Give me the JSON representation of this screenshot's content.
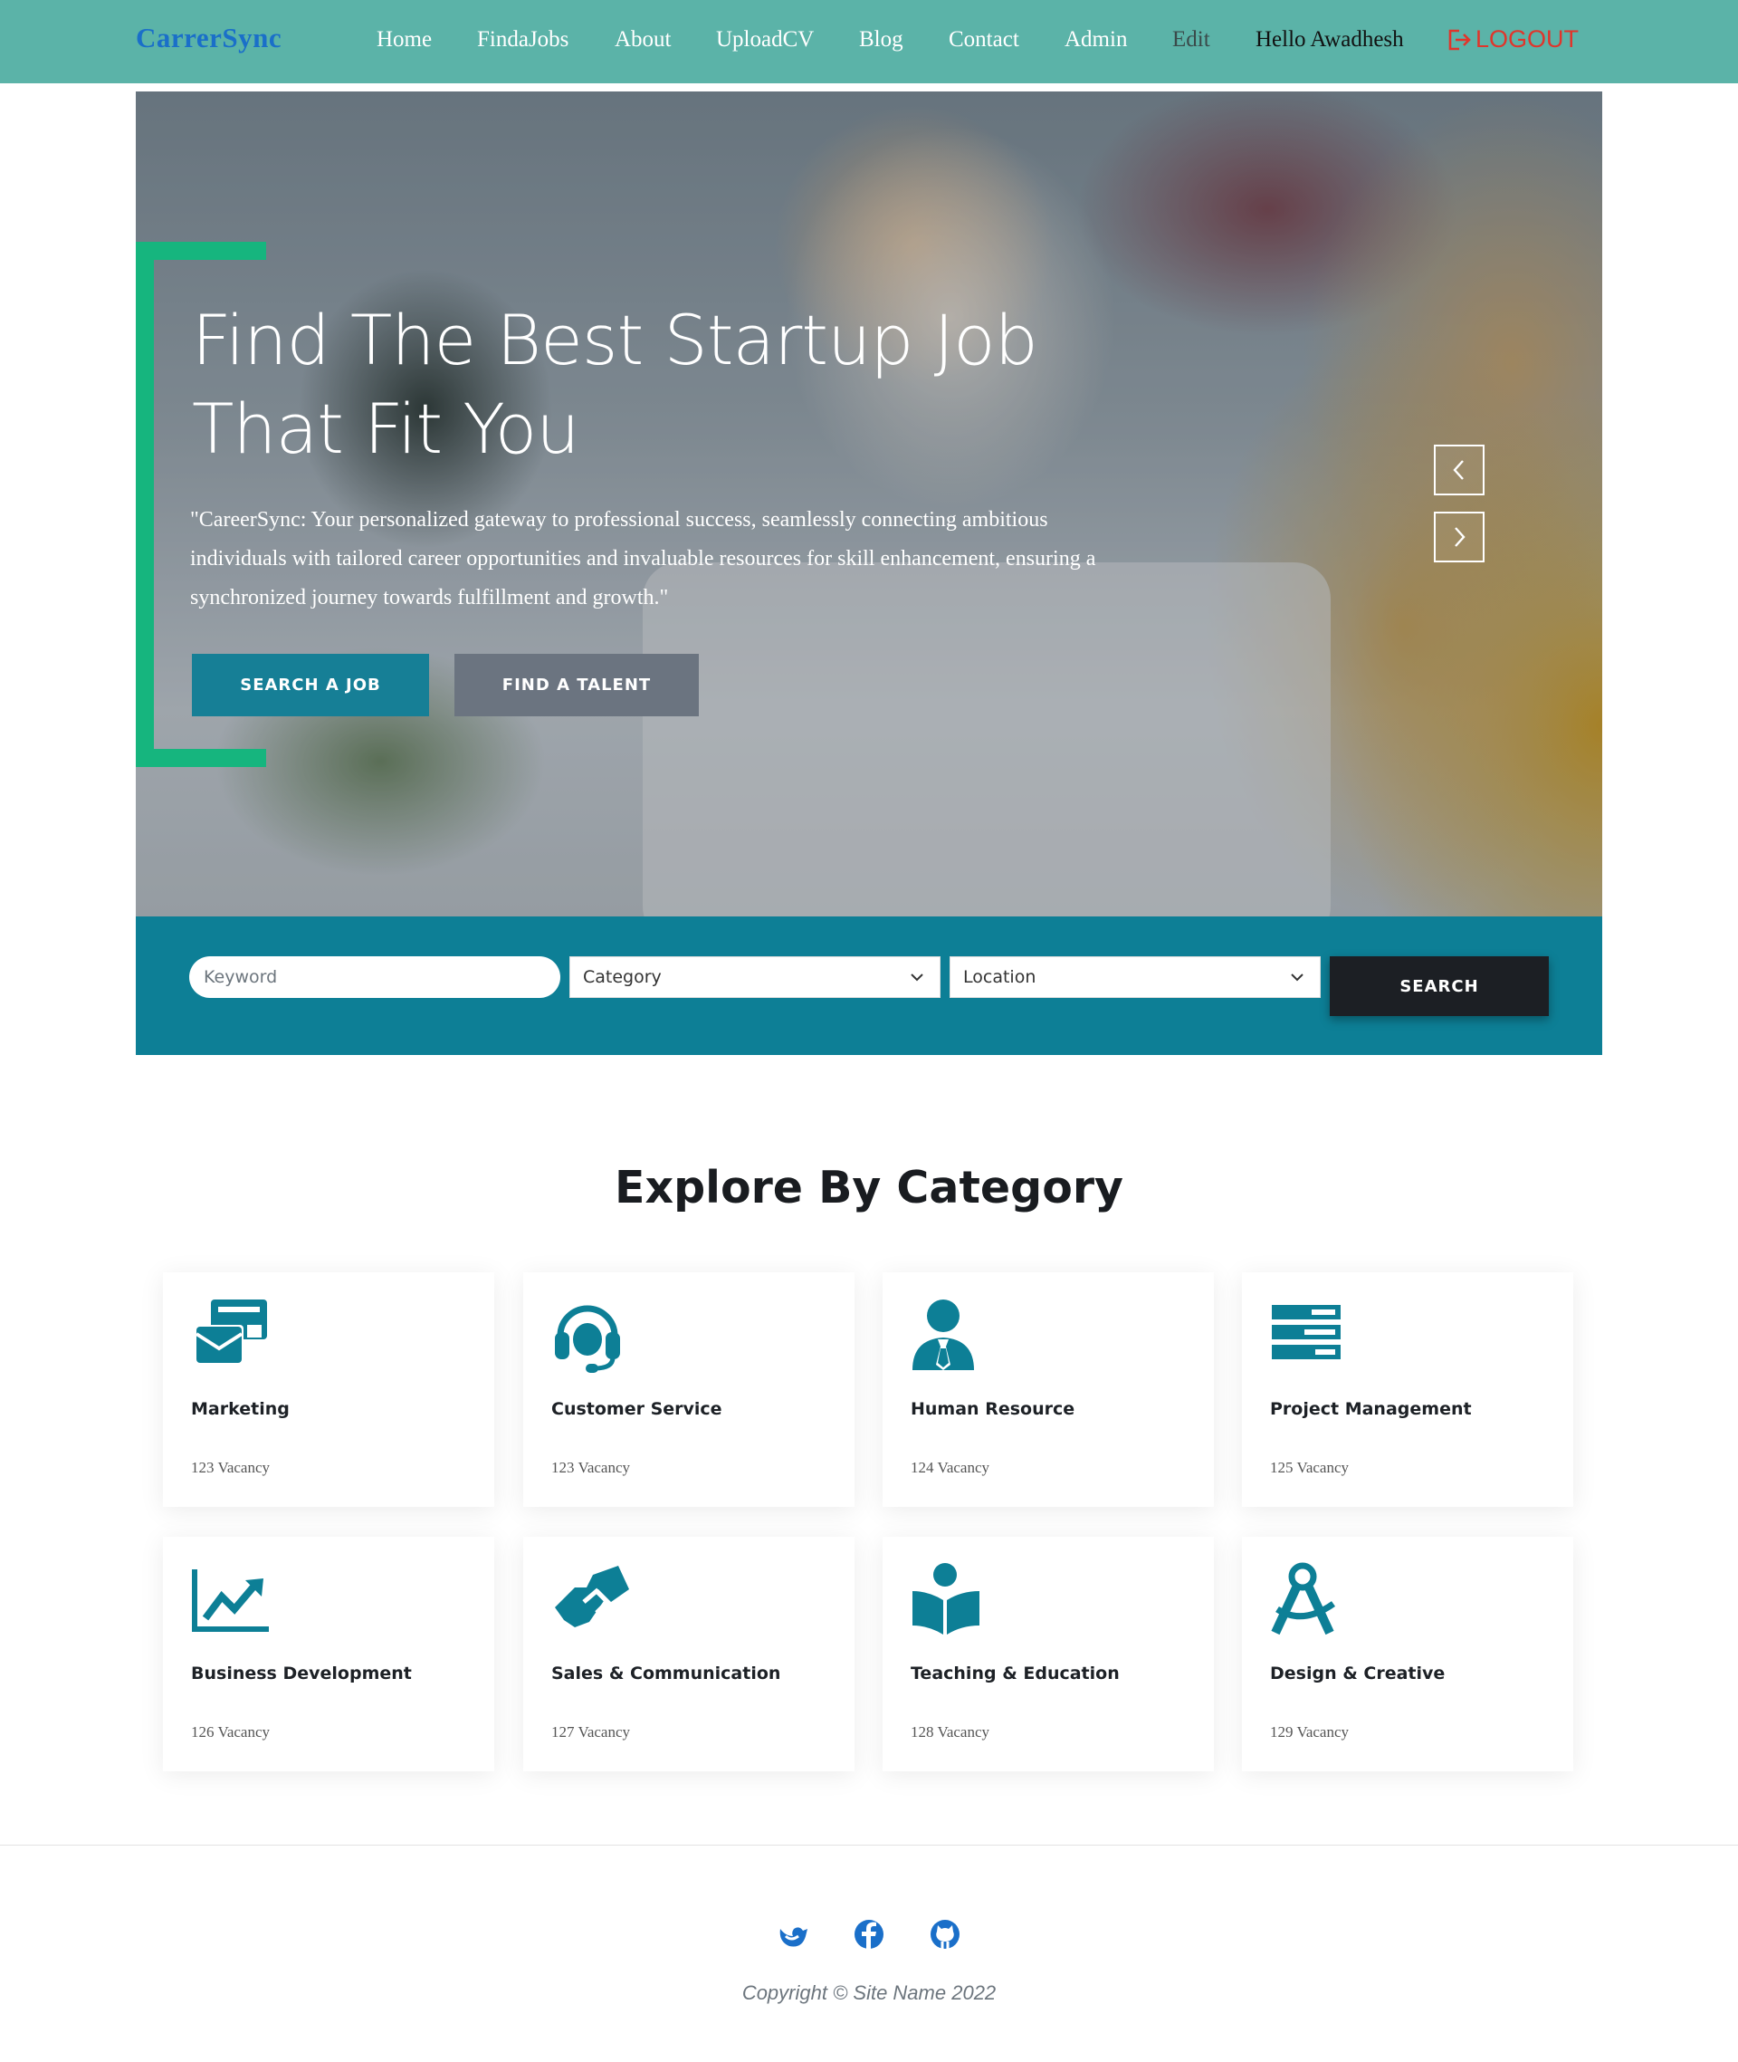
{
  "navbar": {
    "brand": "CarrerSync",
    "links": [
      "Home",
      "FindaJobs",
      "About",
      "UploadCV",
      "Blog",
      "Contact",
      "Admin",
      "Edit"
    ],
    "greeting": "Hello Awadhesh",
    "logout": "LOGOUT",
    "colors": {
      "background": "#5bb3a8",
      "brand": "#1a6fc9",
      "logout": "#e0352b"
    }
  },
  "hero": {
    "title": "Find The Best Startup Job That Fit You",
    "description": "\"CareerSync: Your personalized gateway to professional success, seamlessly connecting ambitious individuals with tailored career opportunities and invaluable resources for skill enhancement, ensuring a synchronized journey towards fulfillment and growth.\"",
    "search_job_button": "SEARCH A JOB",
    "find_talent_button": "FIND A TALENT",
    "prev_icon": "chevron-left-icon",
    "next_icon": "chevron-right-icon",
    "accent": "#16b57e"
  },
  "search": {
    "keyword_placeholder": "Keyword",
    "category_value": "Category",
    "location_value": "Location",
    "button": "SEARCH",
    "background": "#0d7f96"
  },
  "categories": {
    "title": "Explore By Category",
    "icon_color": "#0d7f96",
    "items": [
      {
        "name": "Marketing",
        "count": "123 Vacancy",
        "icon": "mail-bulk-icon"
      },
      {
        "name": "Customer Service",
        "count": "123 Vacancy",
        "icon": "headset-icon"
      },
      {
        "name": "Human Resource",
        "count": "124 Vacancy",
        "icon": "user-tie-icon"
      },
      {
        "name": "Project Management",
        "count": "125 Vacancy",
        "icon": "tasks-icon"
      },
      {
        "name": "Business Development",
        "count": "126 Vacancy",
        "icon": "chart-line-icon"
      },
      {
        "name": "Sales & Communication",
        "count": "127 Vacancy",
        "icon": "handshake-icon"
      },
      {
        "name": "Teaching & Education",
        "count": "128 Vacancy",
        "icon": "book-reader-icon"
      },
      {
        "name": "Design & Creative",
        "count": "129 Vacancy",
        "icon": "drafting-compass-icon"
      }
    ]
  },
  "footer": {
    "social_icons": [
      "twitter-icon",
      "facebook-icon",
      "github-icon"
    ],
    "social_color": "#1a6fc9",
    "copyright": "Copyright © Site Name 2022"
  }
}
